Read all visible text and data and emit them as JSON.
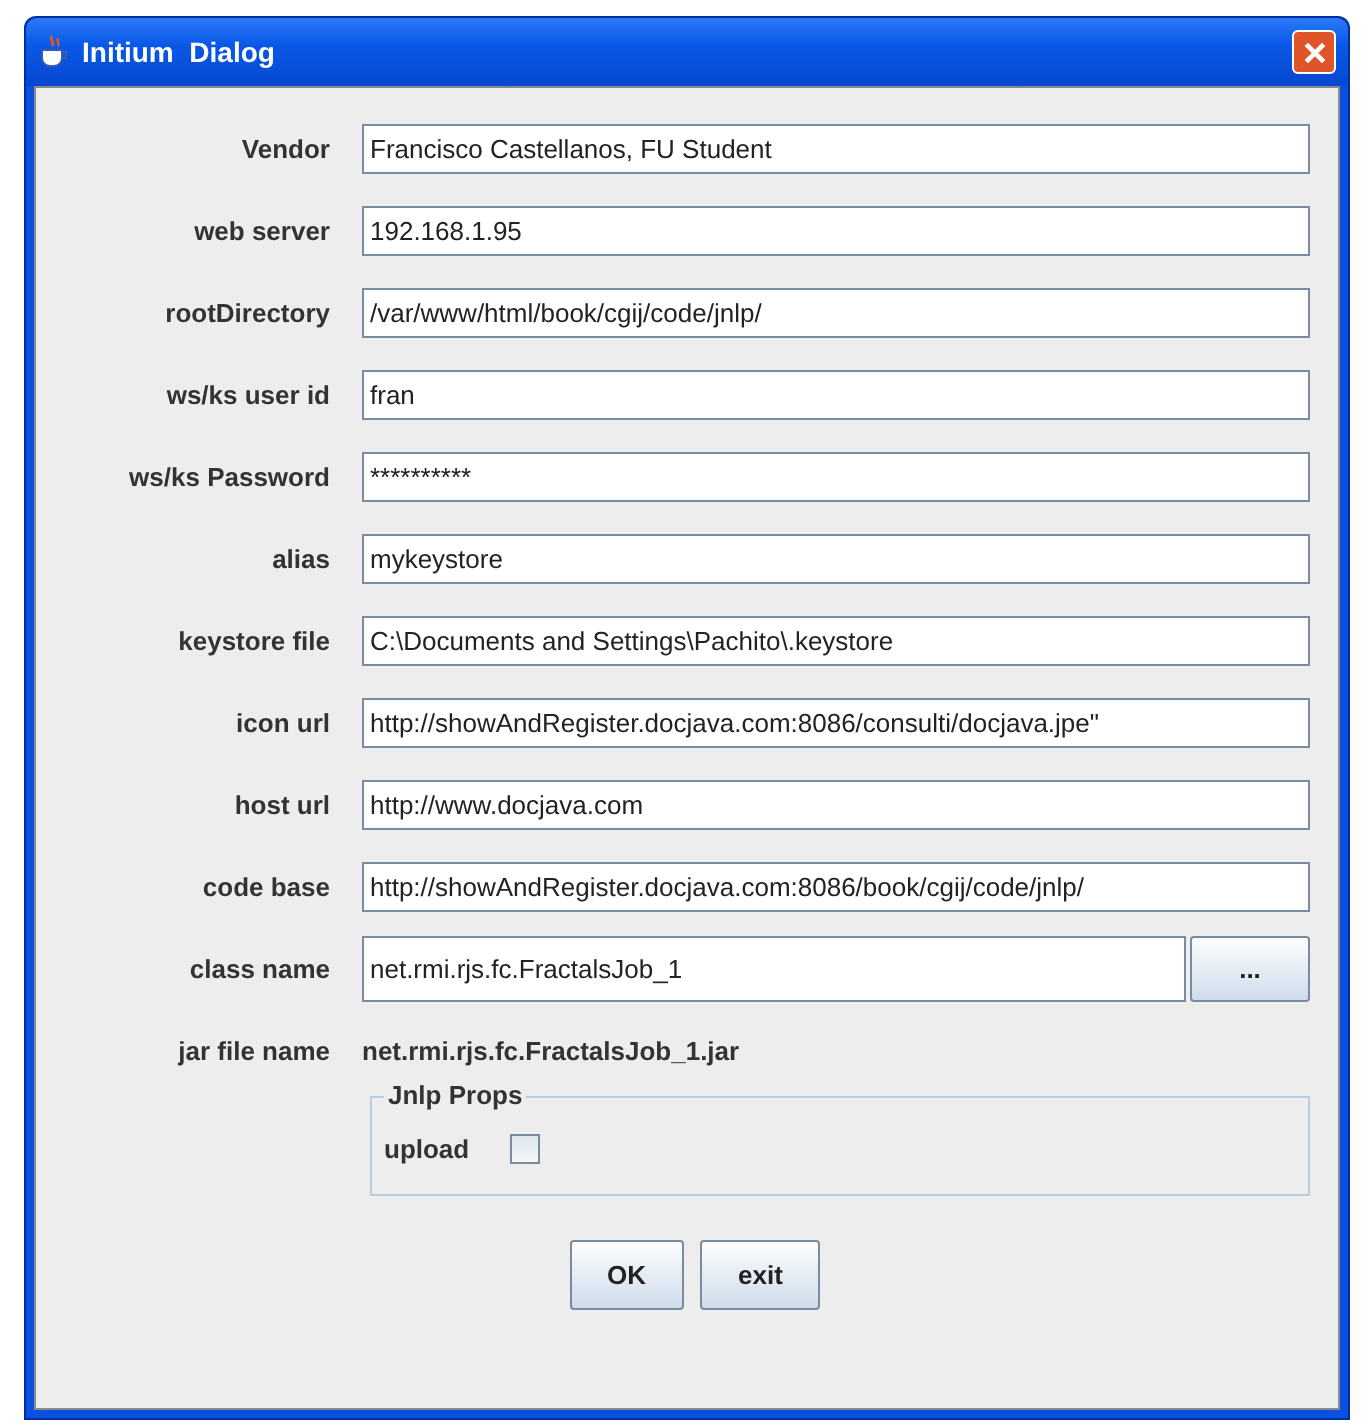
{
  "window": {
    "title": "Initium  Dialog"
  },
  "fields": [
    {
      "label": "Vendor",
      "value": "Francisco Castellanos, FU Student"
    },
    {
      "label": "web server",
      "value": "192.168.1.95"
    },
    {
      "label": "rootDirectory",
      "value": "/var/www/html/book/cgij/code/jnlp/"
    },
    {
      "label": "ws/ks user id",
      "value": "fran"
    },
    {
      "label": "ws/ks Password",
      "value": "**********"
    },
    {
      "label": "alias",
      "value": "mykeystore"
    },
    {
      "label": "keystore file",
      "value": "C:\\Documents and Settings\\Pachito\\.keystore"
    },
    {
      "label": "icon url",
      "value": "http://showAndRegister.docjava.com:8086/consulti/docjava.jpe\""
    },
    {
      "label": "host url",
      "value": "http://www.docjava.com"
    },
    {
      "label": "code base",
      "value": "http://showAndRegister.docjava.com:8086/book/cgij/code/jnlp/"
    }
  ],
  "class_name": {
    "label": "class name",
    "value": "net.rmi.rjs.fc.FractalsJob_1",
    "browse_button": "..."
  },
  "jar_file": {
    "label": "jar file name",
    "value": "net.rmi.rjs.fc.FractalsJob_1.jar"
  },
  "jnlp_props": {
    "title": "Jnlp Props",
    "upload": {
      "label": "upload",
      "checked": false
    }
  },
  "buttons": [
    "OK",
    "exit"
  ]
}
